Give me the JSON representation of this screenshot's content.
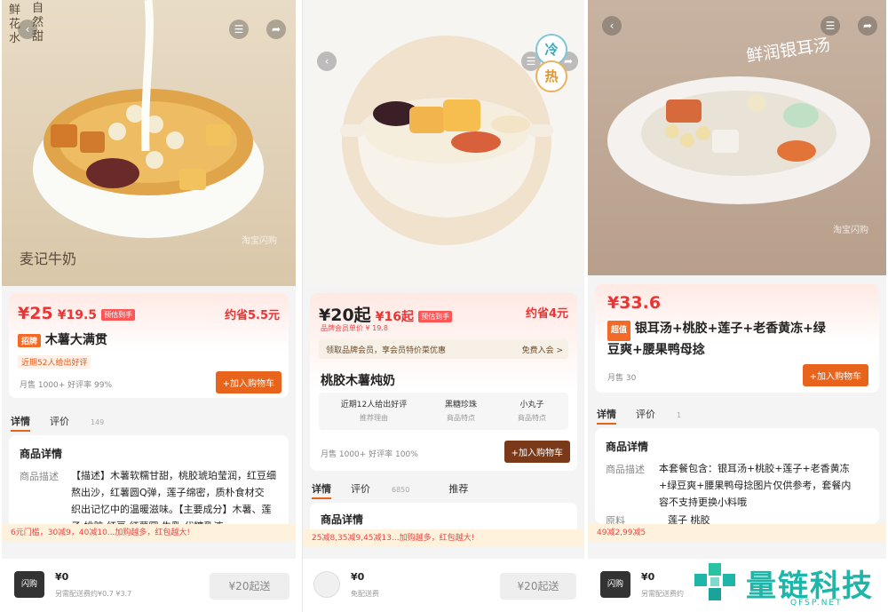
{
  "panel1": {
    "hero_vertical_text": "鲜\n花\n水",
    "hero_side_text": "自\n然\n甜",
    "brand_name": "麦记牛奶",
    "watermark": "淘宝闪购",
    "price_main": "¥25",
    "price_alt": "¥19.5",
    "price_tag": "预估到手",
    "save": "约省5.5元",
    "badge": "招牌",
    "title": "木薯大满贯",
    "review_chip": "近期52人给出好评",
    "sold": "月售 1000+  好评率 99%",
    "cart_button": "+加入购物车",
    "tabs": [
      {
        "label": "详情"
      },
      {
        "label": "评价",
        "count": "149"
      }
    ],
    "section_title": "商品详情",
    "desc_label": "商品描述",
    "desc_lines": [
      "【描述】木薯软糯甘甜，桃胶琥珀莹润，红豆细",
      "熬出沙，红薯圆Q弹，莲子绵密，质朴食材交",
      "织出记忆中的温暖滋味。【主要成分】木薯、莲",
      "子  桃胶  红豆  红薯圆  牛乳  代糖乳液"
    ],
    "promo": "6元门槛，30减9，40减10...加购越多，红包越大!",
    "delivery": "¥0",
    "delivery_sub": "另需配送费约¥0.7 ¥3.7",
    "start_button": "¥20起送",
    "bag_label": "闪购"
  },
  "panel2": {
    "badge_cold": "冷",
    "badge_hot": "热",
    "price_main": "¥20起",
    "price_alt": "¥16起",
    "price_tag": "预估到手",
    "save": "约省4元",
    "member_price": "品牌会员单价 ¥ 19.8",
    "member_banner": "领取品牌会员，享会员特价菜优惠",
    "member_action": "免费入会 >",
    "title": "桃胶木薯炖奶",
    "features": [
      {
        "value": "近期12人给出好评",
        "label": "推荐理由"
      },
      {
        "value": "黑糖珍珠",
        "label": "商品特点"
      },
      {
        "value": "小丸子",
        "label": "商品特点"
      }
    ],
    "sold": "月售 1000+  好评率 100%",
    "cart_button": "+加入购物车",
    "tabs": [
      {
        "label": "详情"
      },
      {
        "label": "评价",
        "count": "6850"
      },
      {
        "label": "推荐"
      }
    ],
    "section_title": "商品详情",
    "promo": "25减8,35减9,45减13...加购越多，红包越大!",
    "delivery": "¥0",
    "delivery_sub": "免配送费",
    "start_button": "¥20起送"
  },
  "panel3": {
    "hero_title": "鲜润银耳汤",
    "watermark": "淘宝闪购",
    "price_main": "¥33.6",
    "badge": "超值",
    "title_lines": [
      "银耳汤+桃胶+莲子+老香黄冻+绿",
      "豆爽+腰果鸭母捻"
    ],
    "sold": "月售 30",
    "cart_button": "+加入购物车",
    "tabs": [
      {
        "label": "详情"
      },
      {
        "label": "评价",
        "count": "1"
      }
    ],
    "section_title": "商品详情",
    "desc_label": "商品描述",
    "desc_lines": [
      "本套餐包含：银耳汤+桃胶+莲子+老香黄冻",
      "+绿豆爽+腰果鸭母捻图片仅供参考，套餐内",
      "容不支持更换小料哦"
    ],
    "desc_label2": "原料",
    "desc_line2": "莲子  桃胶",
    "promo": "49减2,99减5",
    "delivery": "¥0",
    "delivery_sub": "另需配送费约",
    "bag_label": "闪购"
  },
  "brand_logo": {
    "name": "量链科技",
    "sub": "QFSP.NET"
  }
}
